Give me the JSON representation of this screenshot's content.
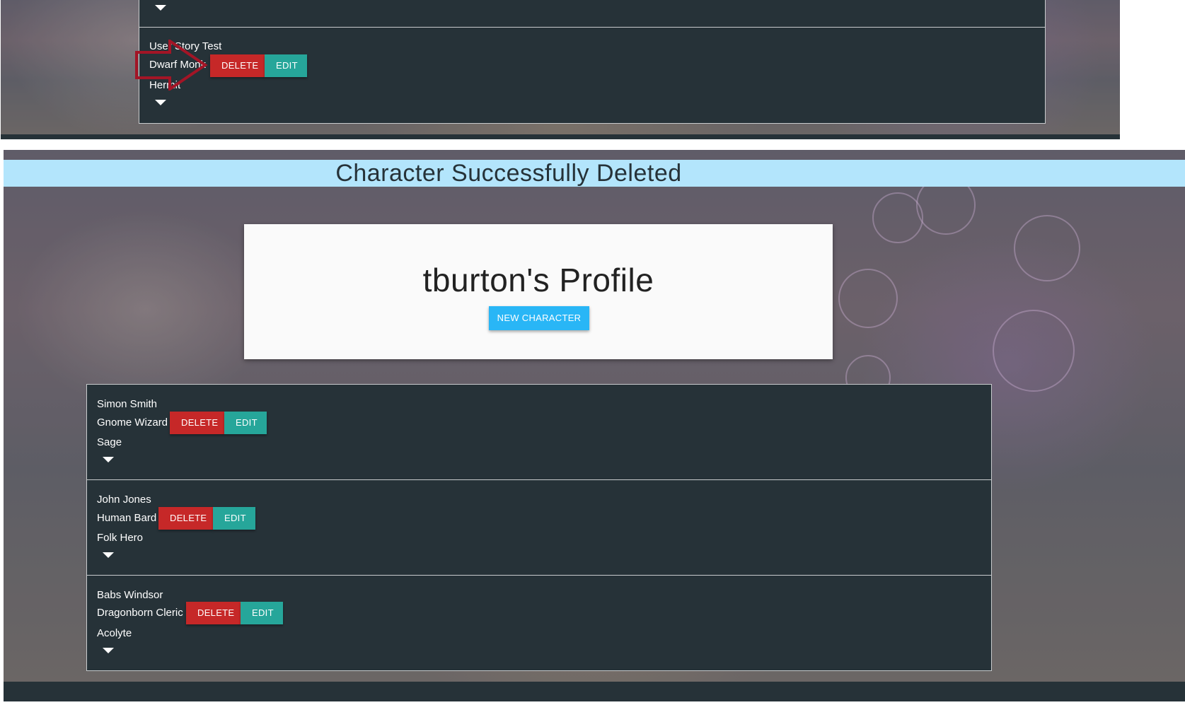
{
  "top": {
    "character": {
      "name": "User Story Test",
      "class": "Dwarf Monk",
      "background": "Hermit",
      "delete_label": "DELETE",
      "edit_label": "EDIT"
    }
  },
  "notification": {
    "message": "Character Successfully Deleted"
  },
  "profile": {
    "title": "tburton's Profile",
    "new_character_label": "NEW CHARACTER"
  },
  "characters": [
    {
      "name": "Simon Smith",
      "class": "Gnome Wizard",
      "background": "Sage",
      "delete_label": "DELETE",
      "edit_label": "EDIT"
    },
    {
      "name": "John Jones",
      "class": "Human Bard",
      "background": "Folk Hero",
      "delete_label": "DELETE",
      "edit_label": "EDIT"
    },
    {
      "name": "Babs Windsor",
      "class": "Dragonborn Cleric",
      "background": "Acolyte",
      "delete_label": "DELETE",
      "edit_label": "EDIT"
    }
  ],
  "icons": {
    "expand": "caret-down-icon",
    "annotation": "arrow-pointer-icon"
  },
  "colors": {
    "panel": "#263238",
    "delete": "#c62828",
    "edit": "#26a69a",
    "banner": "#b3e5fc",
    "primary": "#29b6f6",
    "annotation": "#a31526"
  }
}
